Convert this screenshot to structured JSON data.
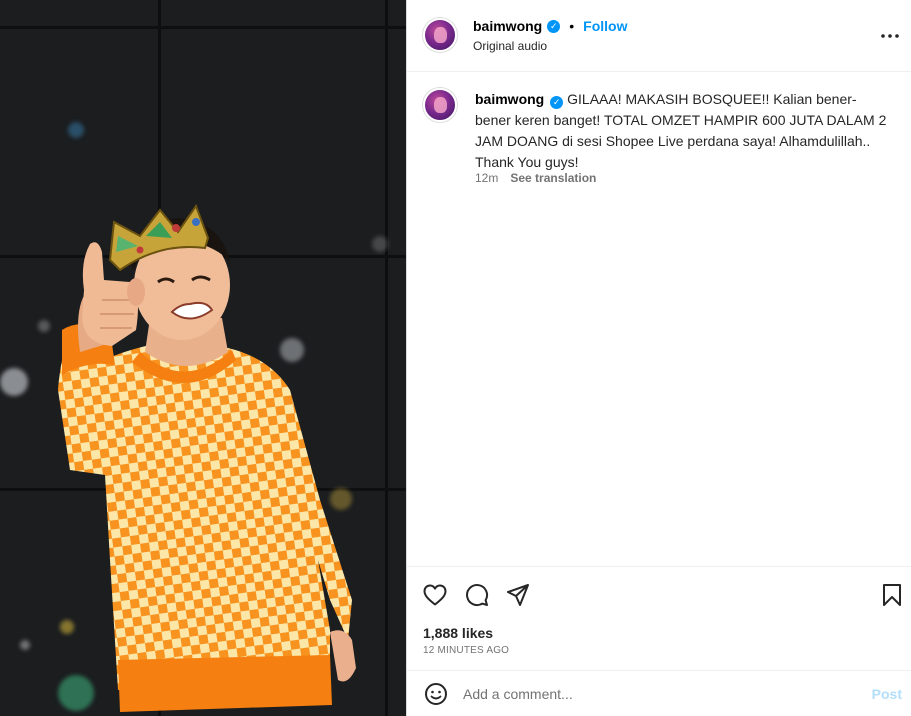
{
  "post": {
    "photo_alt": "Man wearing a crown and orange checkered sweater giving a thumbs up",
    "header": {
      "username": "baimwong",
      "separator": "•",
      "follow_label": "Follow",
      "audio_label": "Original audio",
      "more_icon": "more-horizontal-icon"
    },
    "caption": {
      "username": "baimwong",
      "text": "GILAAA! MAKASIH BOSQUEE!! Kalian bener-bener keren banget! TOTAL OMZET HAMPIR 600 JUTA DALAM 2 JAM DOANG di sesi Shopee Live perdana saya! Alhamdulillah.. Thank You guys!",
      "time": "12m",
      "see_translation": "See translation"
    },
    "actions": {
      "like_icon": "heart-icon",
      "comment_icon": "comment-icon",
      "share_icon": "share-icon",
      "save_icon": "bookmark-icon"
    },
    "likes": "1,888 likes",
    "time_ago": "12 MINUTES AGO",
    "comment_box": {
      "emoji_icon": "emoji-icon",
      "placeholder": "Add a comment...",
      "post_label": "Post"
    }
  },
  "colors": {
    "accent": "#0095f6",
    "post_disabled": "#b3dffc",
    "sweater": "#f7931e",
    "sweater_check": "#fde7a8"
  }
}
